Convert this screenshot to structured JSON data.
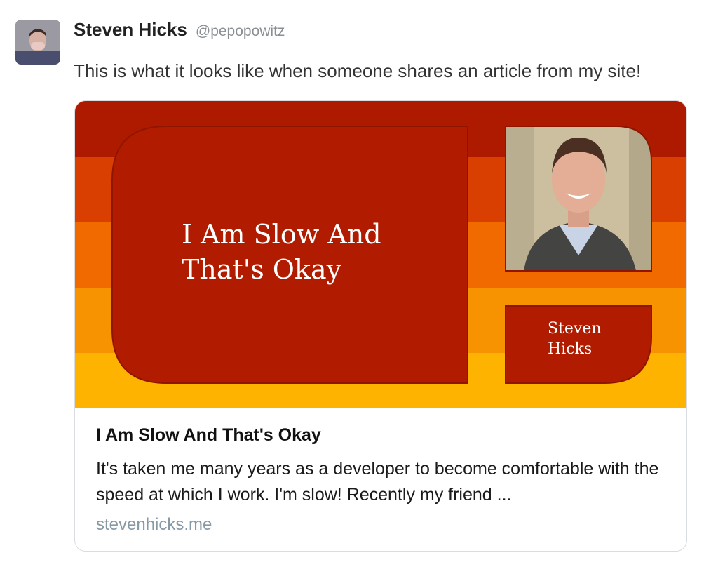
{
  "tweet": {
    "author_name": "Steven Hicks",
    "author_handle": "@pepopowitz",
    "text": "This is what it looks like when someone shares an article from my site!"
  },
  "card": {
    "image": {
      "headline_line1": "I Am Slow And",
      "headline_line2": "That's Okay",
      "name_line1": "Steven",
      "name_line2": "Hicks"
    },
    "title": "I Am Slow And That's Okay",
    "description": "It's taken me many years as a developer to become comfortable with the speed at which I work. I'm slow! Recently my friend ...",
    "domain": "stevenhicks.me"
  },
  "colors": {
    "stripe_1": "#ae1a00",
    "stripe_2": "#d93f00",
    "stripe_3": "#f06a00",
    "stripe_4": "#f79300",
    "stripe_5": "#fdb300",
    "panel": "#b11c00",
    "link_gray": "#8899a6"
  }
}
